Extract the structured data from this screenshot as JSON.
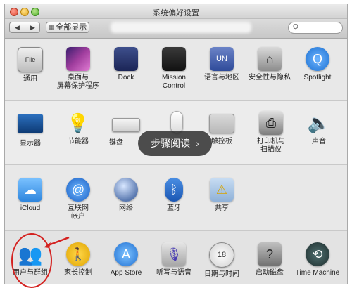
{
  "window": {
    "title": "系统偏好设置"
  },
  "toolbar": {
    "back_glyph": "◀",
    "forward_glyph": "▶",
    "show_all_label": "全部显示",
    "search_glyph": "Q"
  },
  "overlay": {
    "label": "步骤阅读",
    "chevron": "›"
  },
  "rows": [
    [
      {
        "label": "通用",
        "icon": "general-icon",
        "glyph": "File"
      },
      {
        "label": "桌面与\n屏幕保护程序",
        "icon": "desktop-icon",
        "glyph": ""
      },
      {
        "label": "Dock",
        "icon": "dock-icon",
        "glyph": ""
      },
      {
        "label": "Mission\nControl",
        "icon": "mission-control-icon",
        "glyph": ""
      },
      {
        "label": "语言与地区",
        "icon": "language-region-icon",
        "glyph": "UN"
      },
      {
        "label": "安全性与隐私",
        "icon": "security-icon",
        "glyph": "⌂"
      },
      {
        "label": "Spotlight",
        "icon": "spotlight-icon",
        "glyph": "Q"
      }
    ],
    [
      {
        "label": "显示器",
        "icon": "displays-icon",
        "glyph": ""
      },
      {
        "label": "节能器",
        "icon": "energy-saver-icon",
        "glyph": "💡"
      },
      {
        "label": "键盘",
        "icon": "keyboard-icon",
        "glyph": ""
      },
      {
        "label": "",
        "icon": "mouse-icon",
        "glyph": ""
      },
      {
        "label": "触控板",
        "icon": "trackpad-icon",
        "glyph": ""
      },
      {
        "label": "打印机与\n扫描仪",
        "icon": "printer-icon",
        "glyph": "⎙"
      },
      {
        "label": "声音",
        "icon": "sound-icon",
        "glyph": "🔈"
      }
    ],
    [
      {
        "label": "iCloud",
        "icon": "icloud-icon",
        "glyph": "☁"
      },
      {
        "label": "互联网\n帐户",
        "icon": "internet-accounts-icon",
        "glyph": "@"
      },
      {
        "label": "网络",
        "icon": "network-icon",
        "glyph": ""
      },
      {
        "label": "蓝牙",
        "icon": "bluetooth-icon",
        "glyph": "ᛒ"
      },
      {
        "label": "共享",
        "icon": "sharing-icon",
        "glyph": "⚠"
      }
    ],
    [
      {
        "label": "用户与群组",
        "icon": "users-groups-icon",
        "glyph": "👥"
      },
      {
        "label": "家长控制",
        "icon": "parental-controls-icon",
        "glyph": "🚶"
      },
      {
        "label": "App Store",
        "icon": "app-store-icon",
        "glyph": "A"
      },
      {
        "label": "听写与语音",
        "icon": "dictation-icon",
        "glyph": "🎙"
      },
      {
        "label": "日期与时间",
        "icon": "date-time-icon",
        "glyph": "18"
      },
      {
        "label": "启动磁盘",
        "icon": "startup-disk-icon",
        "glyph": "?"
      },
      {
        "label": "Time Machine",
        "icon": "time-machine-icon",
        "glyph": "⟲"
      }
    ]
  ]
}
